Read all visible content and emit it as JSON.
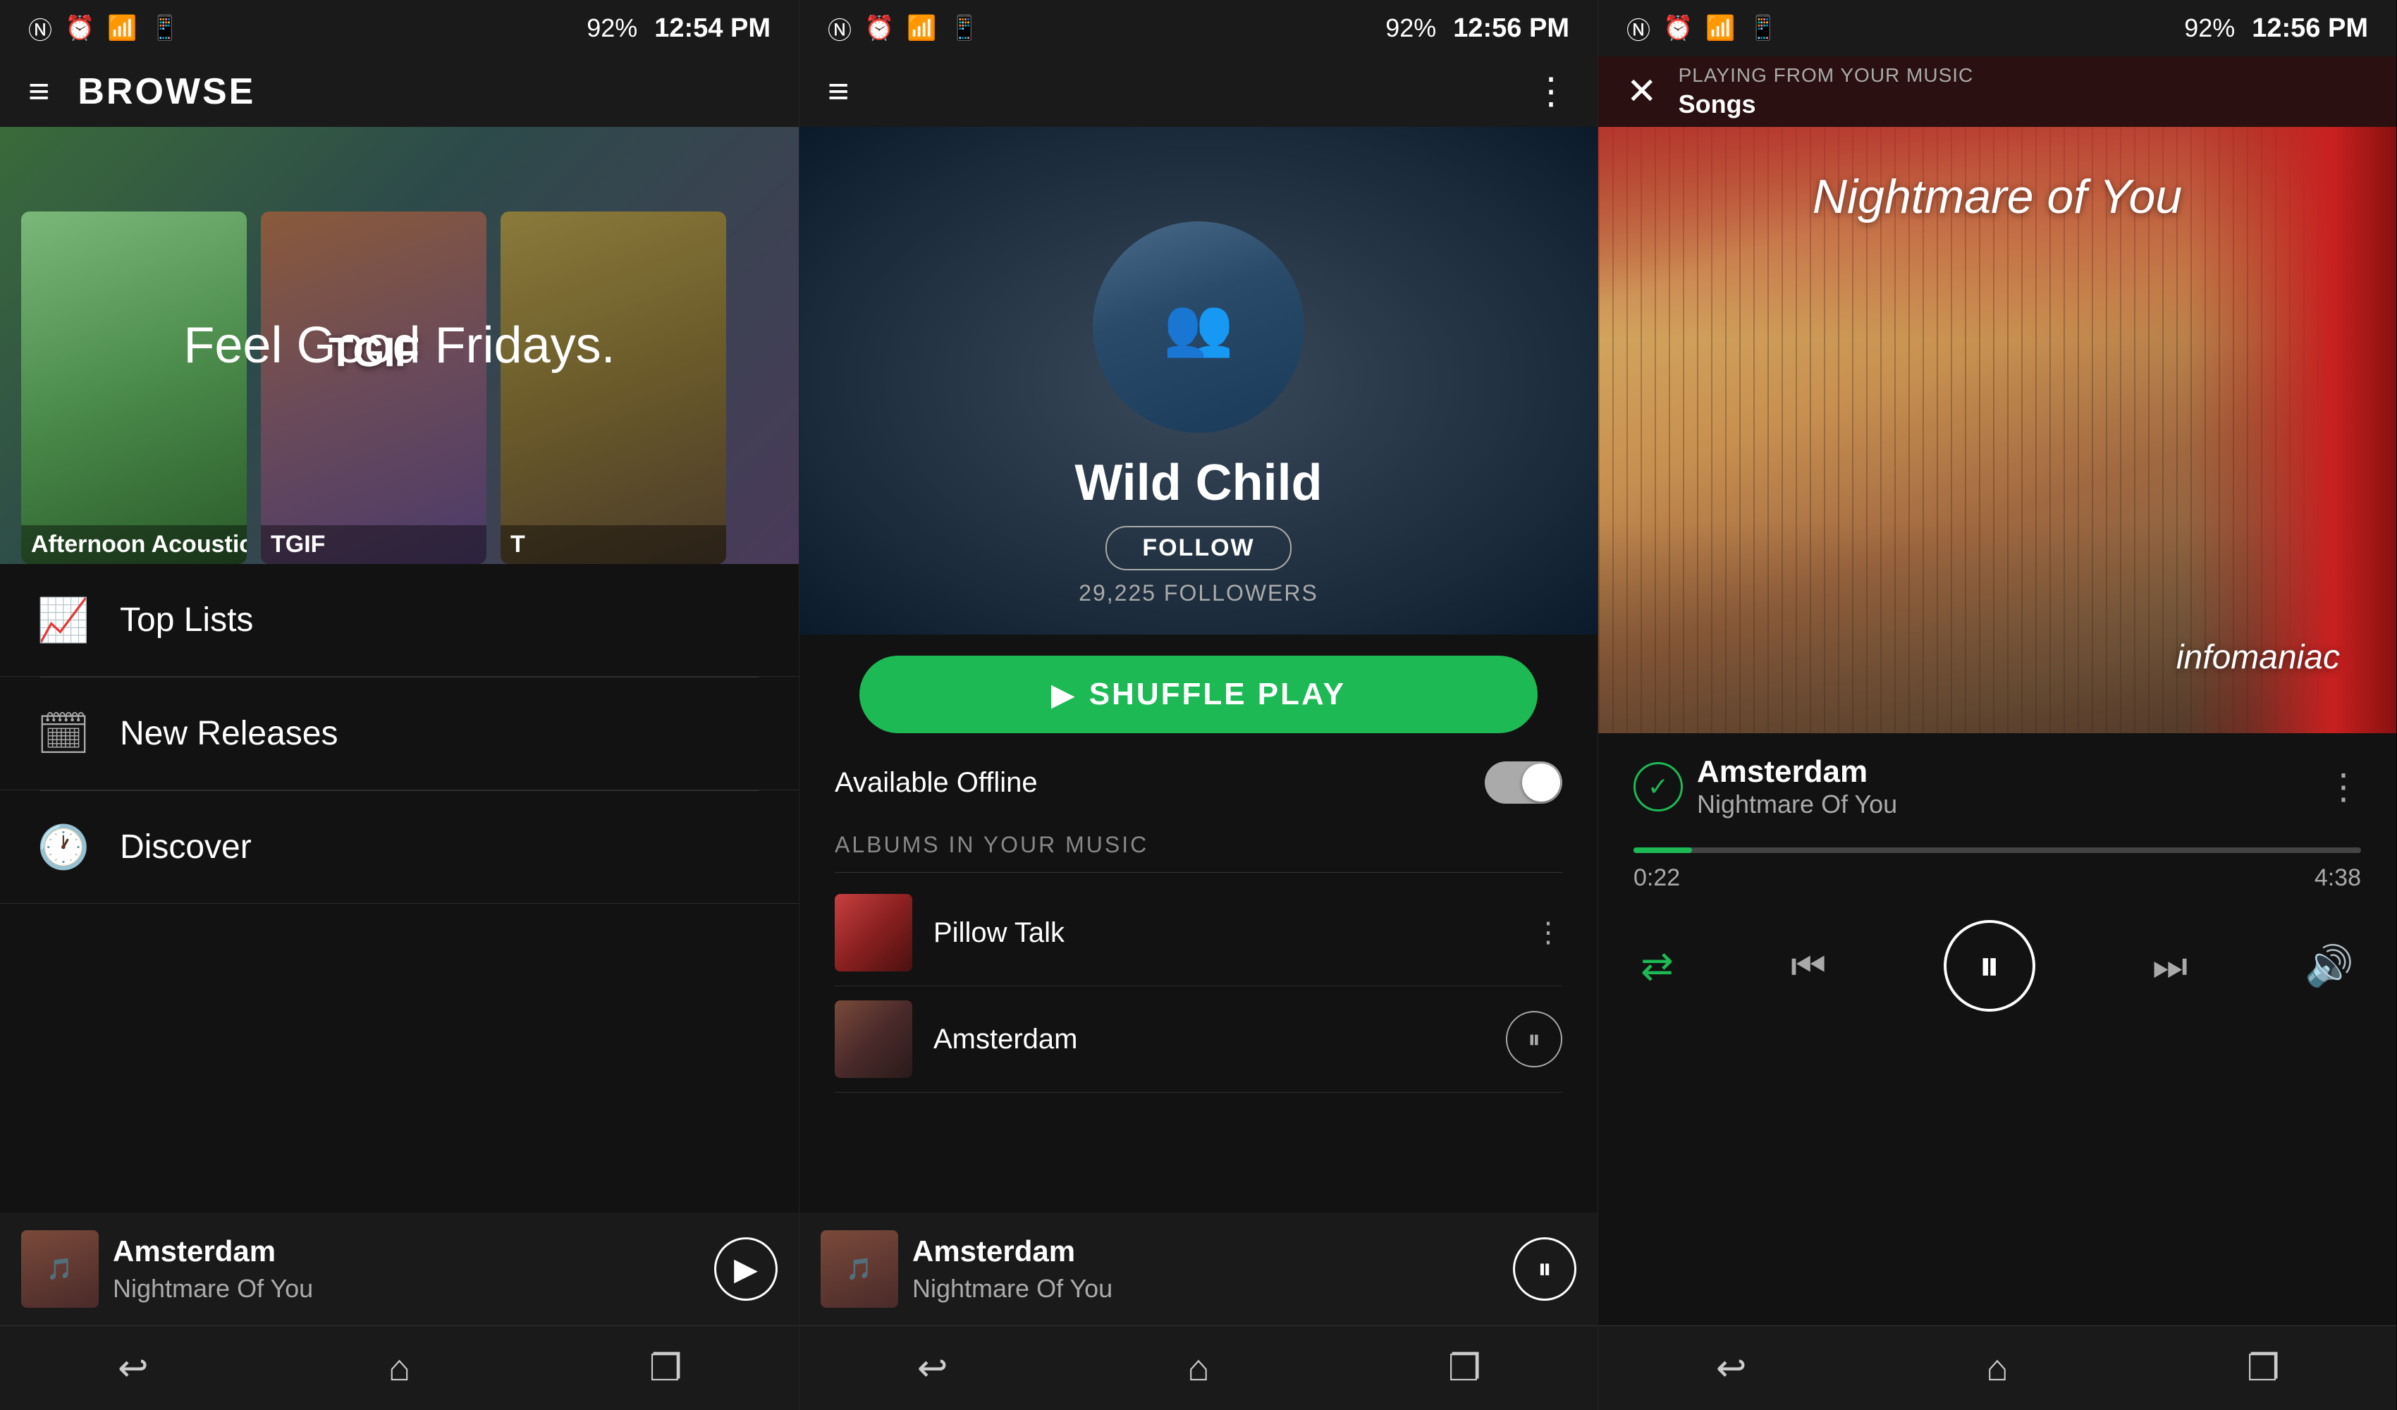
{
  "panel1": {
    "status": {
      "time": "12:54 PM",
      "battery": "92%"
    },
    "nav": {
      "title": "BROWSE",
      "menu_icon": "≡"
    },
    "hero": {
      "title": "Feel Good Fridays.",
      "card1_label": "Afternoon Acoustic",
      "card2_label": "TGIF",
      "card3_label": "T"
    },
    "menu": [
      {
        "icon": "📈",
        "label": "Top Lists"
      },
      {
        "icon": "🗓",
        "label": "New Releases"
      },
      {
        "icon": "🕐",
        "label": "Discover"
      }
    ],
    "now_playing": {
      "title": "Amsterdam",
      "artist": "Nightmare Of You"
    },
    "bottom_nav": [
      "↩",
      "⌂",
      "❐"
    ]
  },
  "panel2": {
    "status": {
      "time": "12:56 PM",
      "battery": "92%"
    },
    "artist": {
      "name": "Wild Child",
      "follow_label": "FOLLOW",
      "followers": "29,225 FOLLOWERS"
    },
    "shuffle_play": "SHUFFLE PLAY",
    "offline": {
      "label": "Available Offline"
    },
    "albums_section_title": "ALBUMS IN YOUR MUSIC",
    "albums": [
      {
        "title": "Pillow Talk"
      },
      {
        "title": "Amsterdam"
      }
    ],
    "now_playing": {
      "title": "Amsterdam",
      "artist": "Nightmare Of You"
    },
    "bottom_nav": [
      "↩",
      "⌂",
      "❐"
    ]
  },
  "panel3": {
    "status": {
      "time": "12:56 PM",
      "battery": "92%"
    },
    "player_header": {
      "subtitle": "PLAYING FROM YOUR MUSIC",
      "source": "Songs"
    },
    "album": {
      "title": "Nightmare of You",
      "subtitle": "infomaniac"
    },
    "track": {
      "title": "Amsterdam",
      "artist": "Nightmare Of You"
    },
    "progress": {
      "current": "0:22",
      "total": "4:38",
      "percent": 8
    },
    "bottom_nav": [
      "↩",
      "⌂",
      "❐"
    ]
  }
}
